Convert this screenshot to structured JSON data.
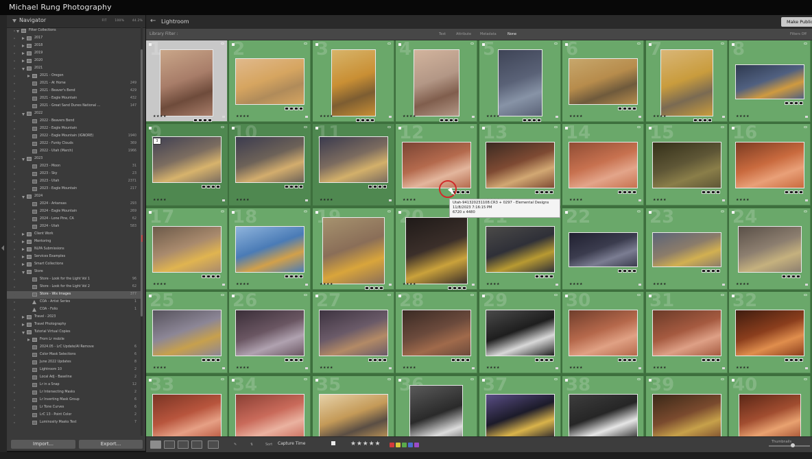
{
  "app": {
    "title": "Michael Rung Photography",
    "module": "Lightroom",
    "publish_button": "Make Public"
  },
  "navigator": {
    "label": "Navigator",
    "zoom_options": [
      "FIT",
      "100%",
      "44.2%"
    ]
  },
  "library_filter": {
    "label": "Library Filter :",
    "tabs": [
      "Text",
      "Attribute",
      "Metadata",
      "None"
    ],
    "active_tab": "None",
    "filters_off": "Filters Off"
  },
  "collections": [
    {
      "name": "Filter Collections",
      "count": "",
      "indent": 1,
      "type": "set",
      "arrow": "open"
    },
    {
      "name": "2017",
      "count": "",
      "indent": 2,
      "type": "set",
      "arrow": "closed"
    },
    {
      "name": "2018",
      "count": "",
      "indent": 2,
      "type": "set",
      "arrow": "closed"
    },
    {
      "name": "2019",
      "count": "",
      "indent": 2,
      "type": "set",
      "arrow": "closed"
    },
    {
      "name": "2020",
      "count": "",
      "indent": 2,
      "type": "set",
      "arrow": "closed"
    },
    {
      "name": "2021",
      "count": "",
      "indent": 2,
      "type": "set",
      "arrow": "open"
    },
    {
      "name": "2021 - Oregon",
      "count": "",
      "indent": 3,
      "type": "set",
      "arrow": "closed"
    },
    {
      "name": "2021 - At Home",
      "count": "249",
      "indent": 3,
      "type": "col",
      "arrow": ""
    },
    {
      "name": "2021 - Beaver's Bend",
      "count": "429",
      "indent": 3,
      "type": "col",
      "arrow": ""
    },
    {
      "name": "2021 - Eagle Mountain",
      "count": "432",
      "indent": 3,
      "type": "col",
      "arrow": ""
    },
    {
      "name": "2021 - Great Sand Dunes National ...",
      "count": "147",
      "indent": 3,
      "type": "col",
      "arrow": ""
    },
    {
      "name": "2022",
      "count": "",
      "indent": 2,
      "type": "set",
      "arrow": "open"
    },
    {
      "name": "2022 - Beavers Bend",
      "count": "",
      "indent": 3,
      "type": "col",
      "arrow": ""
    },
    {
      "name": "2022 - Eagle Mountain",
      "count": "",
      "indent": 3,
      "type": "col",
      "arrow": ""
    },
    {
      "name": "2022 - Eagle Mountain (IGNORE)",
      "count": "1940",
      "indent": 3,
      "type": "col",
      "arrow": ""
    },
    {
      "name": "2022 - Funky Clouds",
      "count": "369",
      "indent": 3,
      "type": "col",
      "arrow": ""
    },
    {
      "name": "2022 - Utah (March)",
      "count": "1966",
      "indent": 3,
      "type": "col",
      "arrow": ""
    },
    {
      "name": "2023",
      "count": "",
      "indent": 2,
      "type": "set",
      "arrow": "open"
    },
    {
      "name": "2023 - Moon",
      "count": "31",
      "indent": 3,
      "type": "col",
      "arrow": ""
    },
    {
      "name": "2023 - Sky",
      "count": "23",
      "indent": 3,
      "type": "col",
      "arrow": ""
    },
    {
      "name": "2023 - Utah",
      "count": "2371",
      "indent": 3,
      "type": "col",
      "arrow": ""
    },
    {
      "name": "2023 - Eagle Mountain",
      "count": "217",
      "indent": 3,
      "type": "col",
      "arrow": ""
    },
    {
      "name": "2024",
      "count": "",
      "indent": 2,
      "type": "set",
      "arrow": "open"
    },
    {
      "name": "2024 - Arkansas",
      "count": "293",
      "indent": 3,
      "type": "col",
      "arrow": ""
    },
    {
      "name": "2024 - Eagle Mountain",
      "count": "269",
      "indent": 3,
      "type": "col",
      "arrow": ""
    },
    {
      "name": "2024 - Lone Pine, CA",
      "count": "62",
      "indent": 3,
      "type": "col",
      "arrow": ""
    },
    {
      "name": "2024 - Utah",
      "count": "583",
      "indent": 3,
      "type": "col",
      "arrow": ""
    },
    {
      "name": "Client Work",
      "count": "",
      "indent": 2,
      "type": "set",
      "arrow": "closed"
    },
    {
      "name": "Mentoring",
      "count": "",
      "indent": 2,
      "type": "set",
      "arrow": "closed"
    },
    {
      "name": "NLPA Submissions",
      "count": "",
      "indent": 2,
      "type": "set",
      "arrow": "closed"
    },
    {
      "name": "Services Examples",
      "count": "",
      "indent": 2,
      "type": "set",
      "arrow": "closed"
    },
    {
      "name": "Smart Collections",
      "count": "",
      "indent": 2,
      "type": "set",
      "arrow": "closed"
    },
    {
      "name": "Store",
      "count": "",
      "indent": 2,
      "type": "set",
      "arrow": "open"
    },
    {
      "name": "Store - Look for the Light Vol 1",
      "count": "96",
      "indent": 3,
      "type": "col",
      "arrow": ""
    },
    {
      "name": "Store - Look for the Light Vol 2",
      "count": "62",
      "indent": 3,
      "type": "col",
      "arrow": ""
    },
    {
      "name": "Store - Wix Images",
      "count": "377",
      "indent": 3,
      "type": "col",
      "arrow": "",
      "selected": true
    },
    {
      "name": "COA - Artist Series",
      "count": "1",
      "indent": 3,
      "type": "pub",
      "arrow": ""
    },
    {
      "name": "COA - Folio",
      "count": "1",
      "indent": 3,
      "type": "pub",
      "arrow": ""
    },
    {
      "name": "Travel - 2023",
      "count": "",
      "indent": 2,
      "type": "set",
      "arrow": "closed"
    },
    {
      "name": "Travel Photography",
      "count": "",
      "indent": 2,
      "type": "set",
      "arrow": "closed"
    },
    {
      "name": "Tutorial Virtual Copies",
      "count": "",
      "indent": 2,
      "type": "set",
      "arrow": "open"
    },
    {
      "name": "From Lr mobile",
      "count": "",
      "indent": 3,
      "type": "set",
      "arrow": "closed"
    },
    {
      "name": "2024.05 - LrC Update/AI Remove",
      "count": "6",
      "indent": 3,
      "type": "col",
      "arrow": ""
    },
    {
      "name": "Color Mask Selections",
      "count": "6",
      "indent": 3,
      "type": "col",
      "arrow": ""
    },
    {
      "name": "June 2022 Updates",
      "count": "8",
      "indent": 3,
      "type": "col",
      "arrow": ""
    },
    {
      "name": "Lightroom 10",
      "count": "2",
      "indent": 3,
      "type": "col",
      "arrow": ""
    },
    {
      "name": "Local Adj - Baseline",
      "count": "2",
      "indent": 3,
      "type": "col",
      "arrow": ""
    },
    {
      "name": "Lr in a Snap",
      "count": "12",
      "indent": 3,
      "type": "col",
      "arrow": ""
    },
    {
      "name": "Lr Intersecting Masks",
      "count": "2",
      "indent": 3,
      "type": "col",
      "arrow": ""
    },
    {
      "name": "Lr Inverting Mask Group",
      "count": "6",
      "indent": 3,
      "type": "col",
      "arrow": ""
    },
    {
      "name": "Lr Tone Curves",
      "count": "6",
      "indent": 3,
      "type": "col",
      "arrow": ""
    },
    {
      "name": "LrC 13 - Point Color",
      "count": "2",
      "indent": 3,
      "type": "col",
      "arrow": ""
    },
    {
      "name": "Luminosity Masks Test",
      "count": "7",
      "indent": 3,
      "type": "col",
      "arrow": ""
    }
  ],
  "buttons": {
    "import": "Import...",
    "export": "Export..."
  },
  "grid": {
    "rows": [
      [
        "1",
        "2",
        "3",
        "4",
        "5",
        "6",
        "7",
        "8"
      ],
      [
        "9",
        "10",
        "11",
        "12",
        "13",
        "14",
        "15",
        "16"
      ],
      [
        "17",
        "18",
        "19",
        "20",
        "21",
        "22",
        "23",
        "24"
      ],
      [
        "25",
        "26",
        "27",
        "28",
        "29",
        "30",
        "31",
        "32"
      ],
      [
        "33",
        "34",
        "35",
        "36",
        "37",
        "38",
        "39",
        "40"
      ]
    ],
    "stars_label": "★★★★",
    "stack_count": "3",
    "colors": {
      "accent_selection": "#6aa86a",
      "grid_bg": "#3d6f3d",
      "panel": "#3a3a3a"
    }
  },
  "tooltip": {
    "line1": "Utah-941320231108.CR3 + 0297 - Elemental Designs",
    "line2": "11/8/2023 7:16:15 PM",
    "line3": "6720 x 4480"
  },
  "toolbar": {
    "sort_label": "Sort",
    "sort_value": "Capture Time",
    "rating_stars": "★★★★★",
    "thumbnails_label": "Thumbnails"
  }
}
